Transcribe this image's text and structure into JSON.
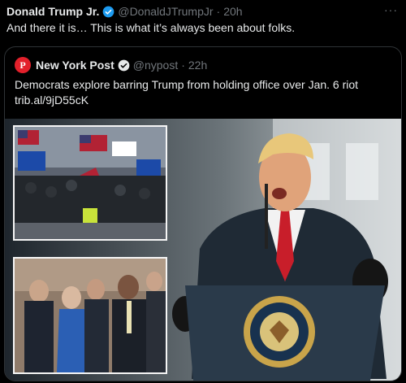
{
  "tweet": {
    "author_name": "Donald Trump Jr.",
    "handle": "@DonaldJTrumpJr",
    "separator": "·",
    "time": "20h",
    "more": "···",
    "text": "And there it is… This is what it’s always been about folks."
  },
  "quoted": {
    "author_name": "New York Post",
    "handle": "@nypost",
    "separator": "·",
    "time": "22h",
    "text_line1": "Democrats explore barring Trump from holding office over Jan. 6 riot",
    "link": "trib.al/9jD55cK",
    "avatar_letter": "P"
  },
  "colors": {
    "background": "#000000",
    "text": "#e7e9ea",
    "muted": "#71767b",
    "border": "#2f3336",
    "verified": "#1d9bf0",
    "nypost_red": "#e3202b"
  },
  "icons": {
    "verified": "verified-badge-icon",
    "more": "more-dots-icon"
  }
}
